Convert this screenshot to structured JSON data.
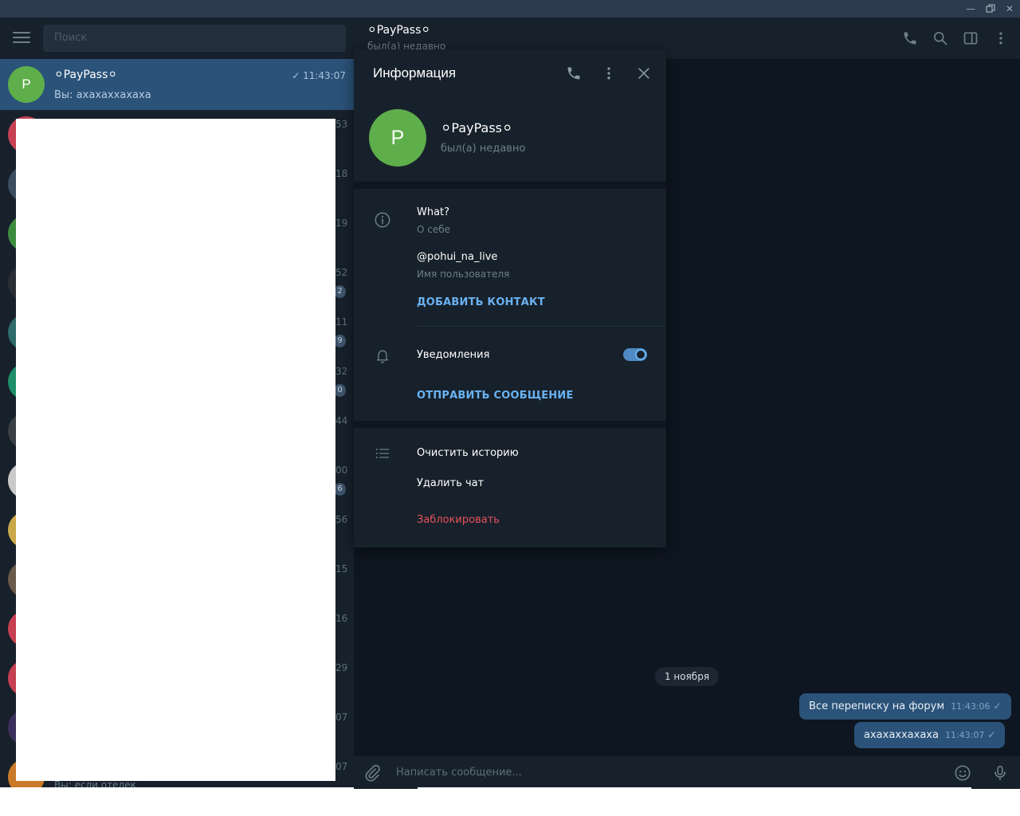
{
  "sidebar": {
    "search_placeholder": "Поиск",
    "active_chat": {
      "avatar_letter": "P",
      "name": "⚪PayPass⚪",
      "time": "11:43:07",
      "preview": "Вы: ахахаххахаха"
    },
    "partial_times": [
      "53",
      "18",
      "19",
      "52",
      "11",
      "32",
      "44",
      "00",
      "56",
      "15",
      "16",
      "29",
      "07",
      "07"
    ],
    "partial_badges": [
      "2",
      "9",
      "0",
      "6"
    ],
    "bottom_preview": "Вы: если отелек"
  },
  "chat": {
    "title": "⚪PayPass⚪",
    "status": "был(а) недавно",
    "date_pill": "1 ноября",
    "messages": [
      {
        "text": "Все переписку на форум",
        "time": "11:43:06"
      },
      {
        "text": "ахахаххахаха",
        "time": "11:43:07"
      }
    ],
    "composer_placeholder": "Написать сообщение..."
  },
  "info": {
    "title": "Информация",
    "avatar_letter": "P",
    "name": "⚪PayPass⚪",
    "status": "был(а) недавно",
    "bio_value": "What?",
    "bio_label": "О себе",
    "username_value": "@pohui_na_live",
    "username_label": "Имя пользователя",
    "add_contact": "ДОБАВИТЬ КОНТАКТ",
    "notifications": "Уведомления",
    "notifications_on": true,
    "send_message": "ОТПРАВИТЬ СООБЩЕНИЕ",
    "clear_history": "Очистить историю",
    "delete_chat": "Удалить чат",
    "block": "Заблокировать"
  },
  "colors": {
    "sidebar_bg": "#17212b",
    "chat_bg": "#0e1621",
    "accent": "#6ab2f2",
    "bubble": "#2b5278",
    "danger": "#e8505b",
    "avatar_green": "#5eae4b"
  },
  "icons": {
    "window": [
      "minimize-icon",
      "restore-icon",
      "close-icon"
    ],
    "header": [
      "phone-icon",
      "search-icon",
      "sidebar-toggle-icon",
      "more-vertical-icon"
    ],
    "info": [
      "phone-icon",
      "more-vertical-icon",
      "close-icon",
      "info-circle-icon",
      "bell-icon",
      "list-icon"
    ],
    "composer": [
      "paperclip-icon",
      "emoji-icon",
      "microphone-icon"
    ]
  }
}
